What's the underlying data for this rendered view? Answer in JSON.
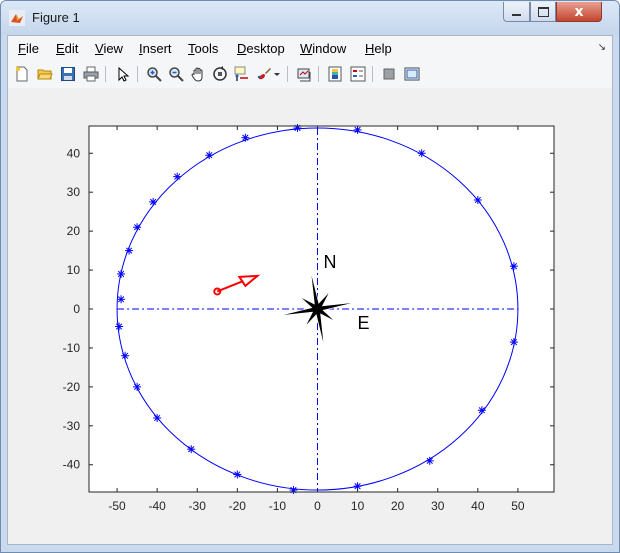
{
  "window": {
    "title": "Figure 1",
    "close_glyph": "x"
  },
  "menu": {
    "items": [
      "File",
      "Edit",
      "View",
      "Insert",
      "Tools",
      "Desktop",
      "Window",
      "Help"
    ],
    "accelerators": [
      "F",
      "E",
      "V",
      "I",
      "T",
      "D",
      "W",
      "H"
    ]
  },
  "toolbar": {
    "buttons": [
      "new-figure-icon",
      "open-file-icon",
      "save-icon",
      "print-icon",
      "pointer-icon",
      "zoom-in-icon",
      "zoom-out-icon",
      "pan-icon",
      "rotate-3d-icon",
      "data-cursor-icon",
      "brush-icon",
      "brush-dropdown-icon",
      "link-plot-icon",
      "insert-colorbar-icon",
      "insert-legend-icon",
      "hide-plot-tools-icon",
      "show-plot-tools-icon"
    ]
  },
  "chart_data": {
    "type": "scatter",
    "xlim": [
      -57,
      59
    ],
    "ylim": [
      -47,
      47
    ],
    "xticks": [
      -50,
      -40,
      -30,
      -20,
      -10,
      0,
      10,
      20,
      30,
      40,
      50
    ],
    "yticks": [
      -40,
      -30,
      -20,
      -10,
      0,
      10,
      20,
      30,
      40
    ],
    "grid": false,
    "circle": {
      "center": [
        0,
        0
      ],
      "radius_x": 50,
      "radius_y": 46.5,
      "color": "#0000ff"
    },
    "axis_lines": {
      "style": "dash-dot",
      "color": "#0000ff"
    },
    "markers": {
      "symbol": "*",
      "color": "#0000ff",
      "points": [
        [
          -5,
          46.5
        ],
        [
          10,
          46
        ],
        [
          26,
          40
        ],
        [
          40,
          28
        ],
        [
          49,
          11
        ],
        [
          49,
          -8.5
        ],
        [
          41,
          -26
        ],
        [
          28,
          -39
        ],
        [
          10,
          -45.5
        ],
        [
          -6,
          -46.5
        ],
        [
          -20,
          -42.5
        ],
        [
          -31.5,
          -36
        ],
        [
          -40,
          -28
        ],
        [
          -45,
          -20
        ],
        [
          -48,
          -12
        ],
        [
          -49.5,
          -4.5
        ],
        [
          -49,
          2.5
        ],
        [
          -49,
          9
        ],
        [
          -47,
          15
        ],
        [
          -45,
          21
        ],
        [
          -41,
          27.5
        ],
        [
          -35,
          34
        ],
        [
          -27,
          39.5
        ],
        [
          -18,
          44
        ]
      ]
    },
    "compass": {
      "labels": [
        "N",
        "E"
      ],
      "color": "#000000"
    },
    "arrow": {
      "from": [
        -25,
        4.5
      ],
      "to": [
        -15,
        8.5
      ],
      "color": "#ff0000"
    }
  }
}
